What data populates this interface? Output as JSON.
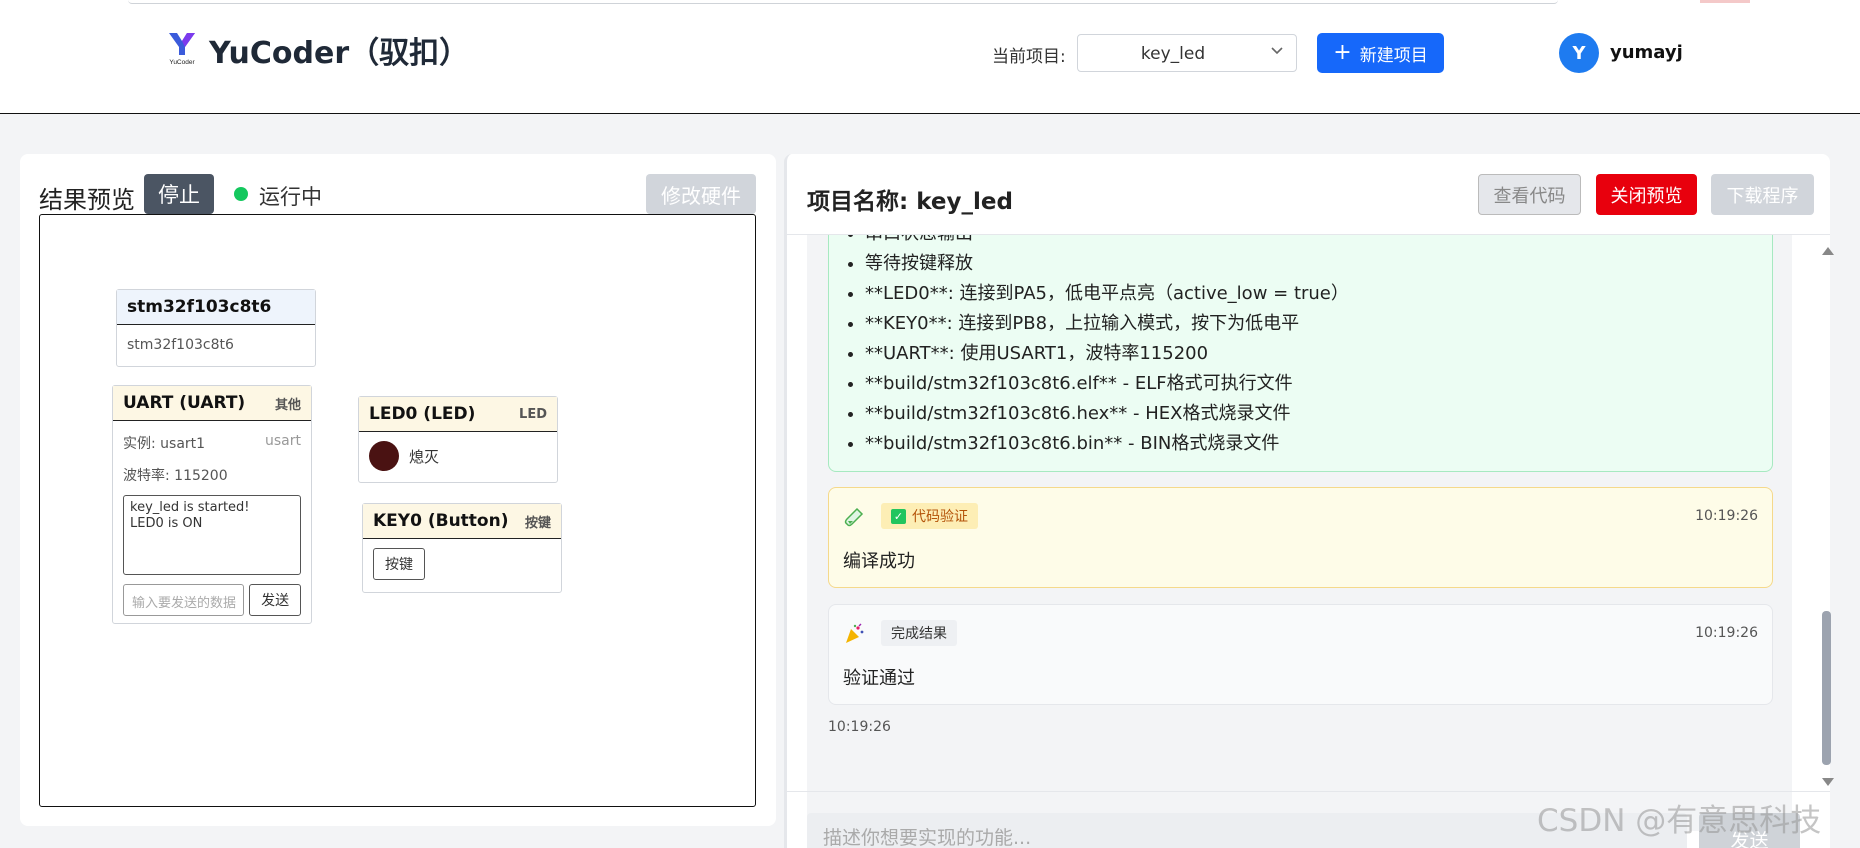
{
  "header": {
    "brand": "YuCoder（驭扣）",
    "logo_text": "YuCoder",
    "project_label": "当前项目:",
    "project_value": "key_led",
    "new_project": "新建项目",
    "avatar_letter": "Y",
    "username": "yumayj"
  },
  "left": {
    "title": "结果预览",
    "stop": "停止",
    "status": "运行中",
    "status_color": "#14c85e",
    "modify_hw": "修改硬件",
    "mcu": {
      "title": "stm32f103c8t6",
      "body": "stm32f103c8t6"
    },
    "uart": {
      "title": "UART (UART)",
      "type": "其他",
      "instance": "实例: usart1",
      "kind": "usart",
      "baud": "波特率: 115200",
      "log": "key_led is started!\nLED0 is ON",
      "input_placeholder": "输入要发送的数据",
      "send": "发送"
    },
    "led": {
      "title": "LED0 (LED)",
      "type": "LED",
      "state": "熄灭"
    },
    "key": {
      "title": "KEY0 (Button)",
      "type": "按键",
      "button": "按键"
    }
  },
  "right": {
    "project_title": "项目名称: key_led",
    "view_code": "查看代码",
    "close_preview": "关闭预览",
    "download": "下载程序",
    "list_items": [
      "串口状态输出",
      "等待按键释放",
      "**LED0**: 连接到PA5，低电平点亮（active_low = true）",
      "**KEY0**: 连接到PB8，上拉输入模式，按下为低电平",
      "**UART**: 使用USART1，波特率115200",
      "**build/stm32f103c8t6.elf** - ELF格式可执行文件",
      "**build/stm32f103c8t6.hex** - HEX格式烧录文件",
      "**build/stm32f103c8t6.bin** - BIN格式烧录文件"
    ],
    "verify": {
      "icon": "test-tube-icon",
      "badge": "代码验证",
      "time": "10:19:26",
      "text": "编译成功"
    },
    "result": {
      "icon": "party-popper-icon",
      "badge": "完成结果",
      "time": "10:19:26",
      "text": "验证通过"
    },
    "chat_time": "10:19:26",
    "input_placeholder": "描述你想要实现的功能...",
    "send": "发送"
  },
  "watermark": "CSDN @有意思科技",
  "colors": {
    "primary": "#1668fa",
    "danger": "#e8000d",
    "success": "#14c85e"
  }
}
